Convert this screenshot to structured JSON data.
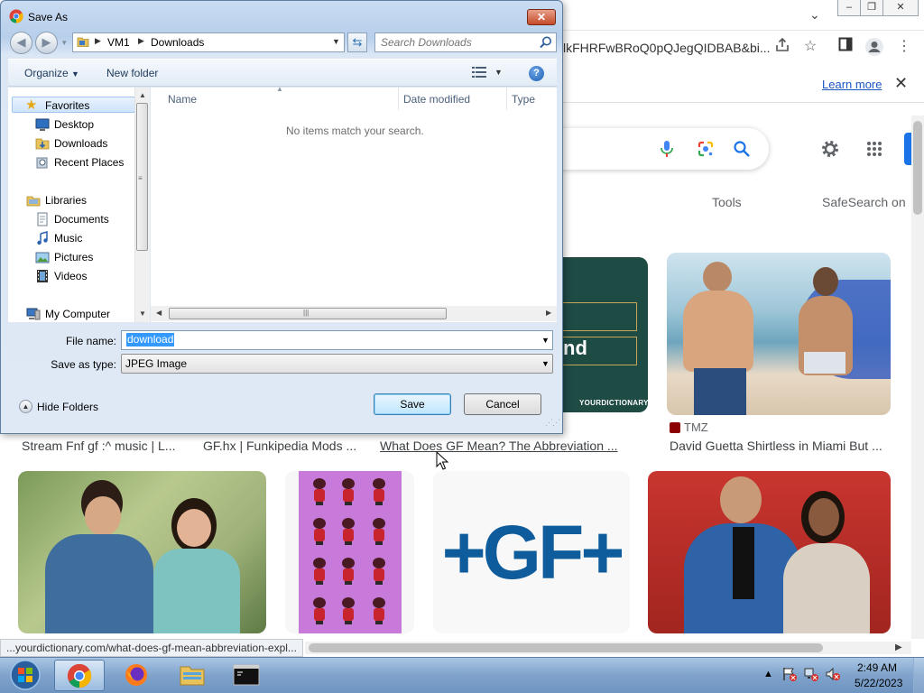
{
  "browser": {
    "url_fragment": "lkFHRFwBRoQ0pQJegQIDBAB&bi...",
    "info_bar": {
      "learn_more": "Learn more"
    },
    "filters": {
      "tools": "Tools",
      "safesearch": "SafeSearch on"
    },
    "results_row1": [
      {
        "caption": "Stream Fnf gf :^ music | L..."
      },
      {
        "caption": "GF.hx | Funkipedia Mods ..."
      },
      {
        "caption": "What Does GF Mean? The Abbreviation ...",
        "image_text": "nd",
        "image_brand": "YOURDICTIONARY"
      },
      {
        "source": "TMZ",
        "caption": "David Guetta Shirtless in Miami But ..."
      }
    ],
    "results_row2": [
      {
        "image_text": "+GF+"
      }
    ],
    "status_url": "...yourdictionary.com/what-does-gf-mean-abbreviation-expl..."
  },
  "dialog": {
    "title": "Save As",
    "path": [
      "VM1",
      "Downloads"
    ],
    "search_placeholder": "Search Downloads",
    "toolbar": {
      "organize": "Organize",
      "new_folder": "New folder"
    },
    "nav": {
      "favorites": "Favorites",
      "desktop": "Desktop",
      "downloads": "Downloads",
      "recent_places": "Recent Places",
      "libraries": "Libraries",
      "documents": "Documents",
      "music": "Music",
      "pictures": "Pictures",
      "videos": "Videos",
      "my_computer": "My Computer"
    },
    "columns": {
      "name": "Name",
      "date_modified": "Date modified",
      "type": "Type"
    },
    "empty_message": "No items match your search.",
    "file_name_label": "File name:",
    "file_name_value": "download",
    "save_type_label": "Save as type:",
    "save_type_value": "JPEG Image",
    "hide_folders": "Hide Folders",
    "save_button": "Save",
    "cancel_button": "Cancel"
  },
  "taskbar": {
    "time": "2:49 AM",
    "date": "5/22/2023"
  },
  "colors": {
    "google_blue": "#1a73e8",
    "gf_blue": "#0f5c9c",
    "selection": "#3399ff"
  }
}
